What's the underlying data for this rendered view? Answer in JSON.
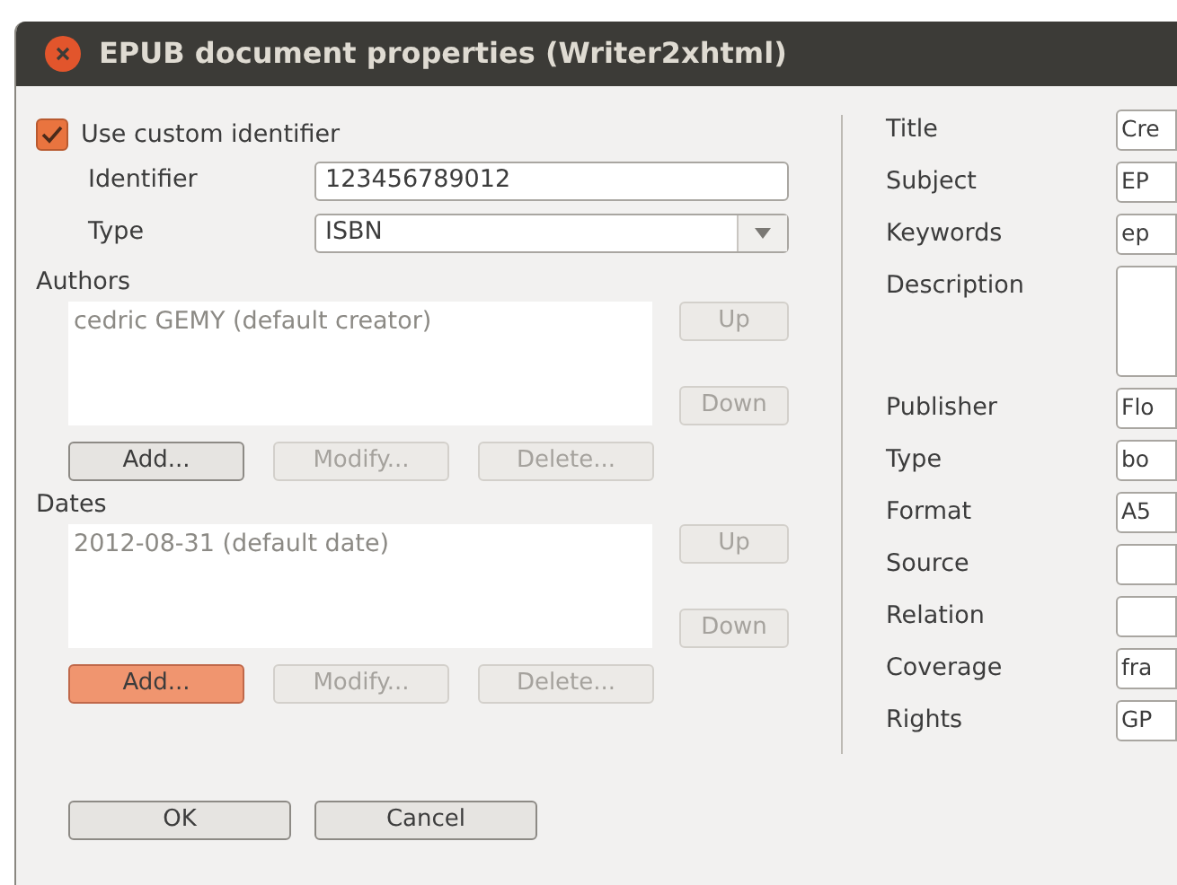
{
  "window": {
    "title": "EPUB document properties (Writer2xhtml)"
  },
  "identifier": {
    "use_custom": {
      "label": "Use custom identifier",
      "checked": true
    },
    "fields": [
      {
        "label": "Identifier",
        "kind": "text",
        "value": "123456789012"
      },
      {
        "label": "Type",
        "kind": "dropdown",
        "value": "ISBN"
      }
    ]
  },
  "sections": [
    {
      "label": "Authors",
      "items": [
        "cedric GEMY (default creator)"
      ],
      "side_buttons": [
        {
          "label": "Up",
          "disabled": true
        },
        {
          "label": "Down",
          "disabled": true
        }
      ],
      "buttons": [
        {
          "label": "Add...",
          "disabled": false,
          "focused": false
        },
        {
          "label": "Modify...",
          "disabled": true,
          "focused": false
        },
        {
          "label": "Delete...",
          "disabled": true,
          "focused": false
        }
      ]
    },
    {
      "label": "Dates",
      "items": [
        "2012-08-31 (default date)"
      ],
      "side_buttons": [
        {
          "label": "Up",
          "disabled": true
        },
        {
          "label": "Down",
          "disabled": true
        }
      ],
      "buttons": [
        {
          "label": "Add...",
          "disabled": false,
          "focused": true
        },
        {
          "label": "Modify...",
          "disabled": true,
          "focused": false
        },
        {
          "label": "Delete...",
          "disabled": true,
          "focused": false
        }
      ]
    }
  ],
  "properties": [
    {
      "label": "Title",
      "kind": "text",
      "value": "Cre"
    },
    {
      "label": "Subject",
      "kind": "text",
      "value": "EP"
    },
    {
      "label": "Keywords",
      "kind": "text",
      "value": "ep"
    },
    {
      "label": "Description",
      "kind": "multiline"
    },
    {
      "label": "Publisher",
      "kind": "text",
      "value": "Flo"
    },
    {
      "label": "Type",
      "kind": "text",
      "value": "bo"
    },
    {
      "label": "Format",
      "kind": "text",
      "value": "A5"
    },
    {
      "label": "Source",
      "kind": "text"
    },
    {
      "label": "Relation",
      "kind": "text"
    },
    {
      "label": "Coverage",
      "kind": "text",
      "value": "fra"
    },
    {
      "label": "Rights",
      "kind": "text",
      "value": "GP"
    }
  ],
  "footer_buttons": [
    "OK",
    "Cancel"
  ]
}
